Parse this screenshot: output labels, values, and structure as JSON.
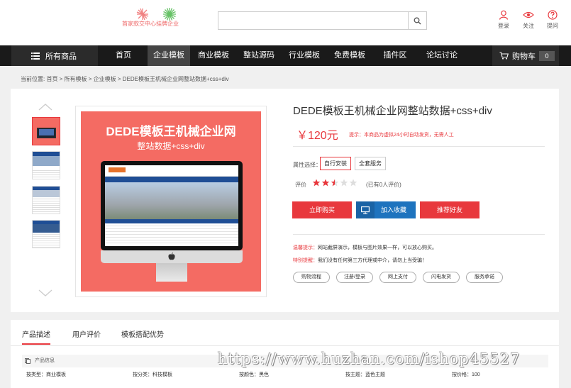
{
  "header": {
    "logo_text": "首家款交中心挂牌企业",
    "search_placeholder": "",
    "tools": [
      {
        "label": "登录",
        "icon": "user-icon"
      },
      {
        "label": "关注",
        "icon": "eye-icon"
      },
      {
        "label": "提问",
        "icon": "question-icon"
      }
    ],
    "accent_color": "#e8383d"
  },
  "nav": {
    "all_categories": "所有商品",
    "items": [
      "首页",
      "企业模板",
      "商业模板",
      "整站源码",
      "行业模板",
      "免费模板",
      "插件区",
      "论坛讨论"
    ],
    "active_index": 1,
    "cart_label": "购物车",
    "cart_count": "0"
  },
  "breadcrumb": "当前位置: 首页  >  所有模板  >  企业模板  >  DEDE模板王机械企业网整站数据+css+div",
  "product": {
    "title": "DEDE模板王机械企业网整站数据+css+div",
    "price": "￥120元",
    "price_note": "提示：本商品为虚拟24小时自动发货，无需人工",
    "image_headline": "DEDE模板王机械企业网",
    "image_subline": "整站数据+css+div",
    "attr_label": "属性选择：",
    "attr_options": [
      "自行安装",
      "全套服务"
    ],
    "rating_label": "评价",
    "rating_value": 2.5,
    "rating_max": 5,
    "rating_text": "(已有0人评价)",
    "buttons": {
      "buy": "立即购买",
      "cart": "加入收藏",
      "recommend": "推荐好友"
    },
    "tip1_label": "温馨提示：",
    "tip1_text": "网站截屏演示，模板与图片效果一样，可以放心购买。",
    "tip2_label": "特别提醒：",
    "tip2_text": "我们没有任何第三方代理或中介，请勿上当受骗！",
    "service_tags": [
      "购物流程",
      "注册/登录",
      "网上支付",
      "闪电发货",
      "服务承诺"
    ]
  },
  "tabs": {
    "items": [
      "产品描述",
      "用户评价",
      "模板搭配优势"
    ],
    "active_index": 0,
    "info_head": "产品信息",
    "info_cells": [
      "按类型：商业模板",
      "按分类：科技模板",
      "按颜色：黑色",
      "按主题：蓝色主题",
      "按价格：100"
    ]
  },
  "watermark": "https://www.huzhan.com/ishop45527"
}
